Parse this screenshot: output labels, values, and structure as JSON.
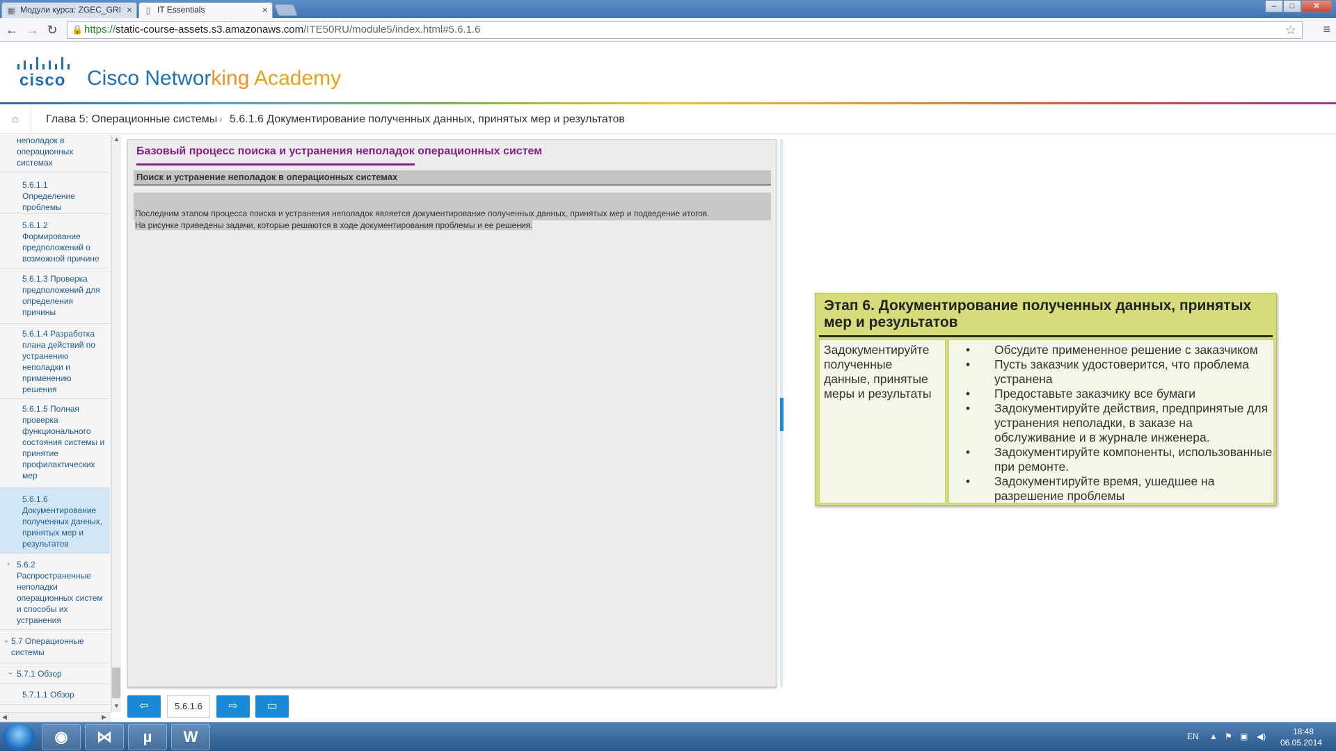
{
  "browser": {
    "tabs": [
      {
        "label": "Модули курса: ZGEC_GRI"
      },
      {
        "label": "IT Essentials"
      }
    ],
    "url": {
      "https": "https://",
      "host": "static-course-assets.s3.amazonaws.com",
      "path": "/ITE50RU/module5/index.html#5.6.1.6"
    }
  },
  "header": {
    "logo_word": "cisco",
    "title_parts": [
      "Cisco Networ",
      "king ",
      "Academy"
    ],
    "colors": {
      "brand_blue": "#1e6fb5",
      "accent_orange": "#f39021"
    }
  },
  "breadcrumb": {
    "chapter": "Глава 5: Операционные системы",
    "section": "5.6.1.6 Документирование полученных данных, принятых мер и результатов"
  },
  "sidebar": {
    "items": [
      {
        "label": "неполадок в операционных системах"
      },
      {
        "label": "5.6.1.1 Определение проблемы"
      },
      {
        "label": "5.6.1.2 Формирование предположений о возможной причине"
      },
      {
        "label": "5.6.1.3 Проверка предположений для определения причины"
      },
      {
        "label": "5.6.1.4 Разработка плана действий по устранению неполадки и применению решения"
      },
      {
        "label": "5.6.1.5 Полная проверка функционального состояния системы и принятие профилактических мер"
      },
      {
        "label": "5.6.1.6 Документирование полученных данных, принятых мер и результатов"
      },
      {
        "label": "5.6.2 Распространенные неполадки операционных систем и способы их устранения"
      },
      {
        "label": "5.7 Операционные системы"
      },
      {
        "label": "5.7.1 Обзор"
      },
      {
        "label": "5.7.1.1 Обзор"
      }
    ]
  },
  "content": {
    "title": "Базовый процесс поиска и устранения неполадок операционных систем",
    "subtitle": "Поиск и устранение неполадок в операционных системах",
    "paragraph_line1": "Последним этапом процесса поиска и устранения неполадок является документирование полученных данных, принятых мер и подведение итогов.",
    "paragraph_line2": "На рисунке приведены задачи, которые решаются в ходе документирования проблемы и ее решения."
  },
  "stage": {
    "title": "Этап 6. Документирование полученных данных, принятых мер и результатов",
    "left_text": "Задокументируйте полученные данные, принятые меры и результаты",
    "bullets": [
      "Обсудите примененное решение с заказчиком",
      "Пусть заказчик удостоверится, что проблема устранена",
      "Предоставьте заказчику все бумаги",
      "Задокументируйте действия, предпринятые для устранения неполадки, в заказе на обслуживание и в журнале инженера.",
      "Задокументируйте компоненты, использованные при ремонте.",
      "Задокументируйте время, ушедшее на разрешение проблемы"
    ],
    "bullet_glyph": "•"
  },
  "pager": {
    "current": "5.6.1.6"
  },
  "taskbar": {
    "lang": "EN",
    "time": "18:48",
    "date": "06.05.2014"
  }
}
